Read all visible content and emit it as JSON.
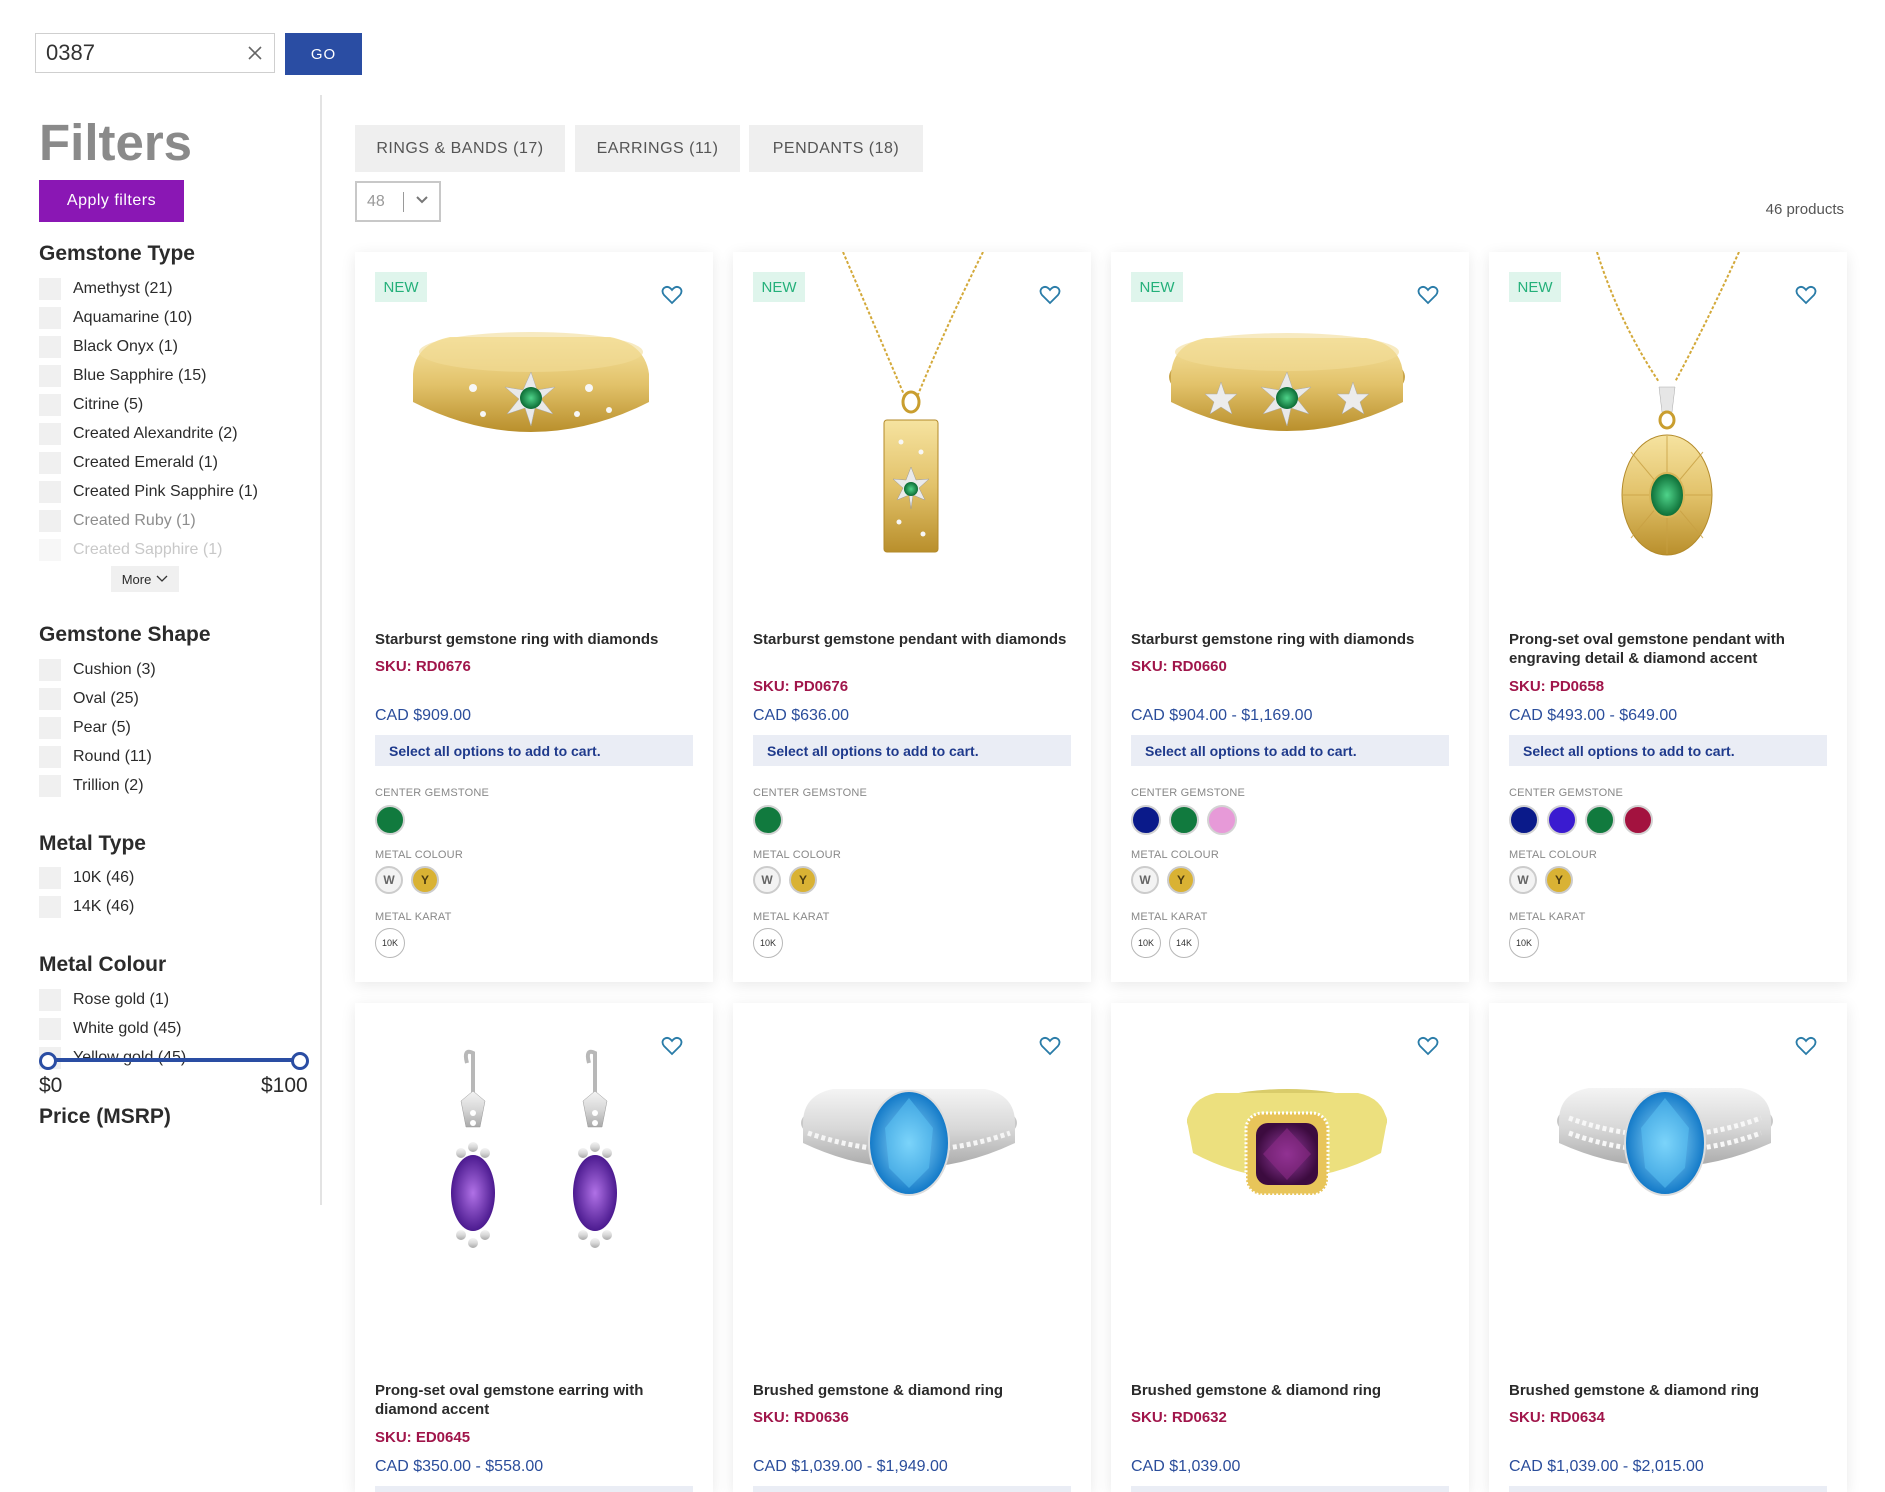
{
  "search": {
    "value": "0387",
    "go_label": "GO"
  },
  "filters": {
    "title": "Filters",
    "apply_label": "Apply filters",
    "more_label": "More",
    "groups": {
      "gemstone_type": {
        "title": "Gemstone Type",
        "options": [
          "Amethyst (21)",
          "Aquamarine (10)",
          "Black Onyx (1)",
          "Blue Sapphire (15)",
          "Citrine (5)",
          "Created Alexandrite (2)",
          "Created Emerald (1)",
          "Created Pink Sapphire (1)",
          "Created Ruby (1)",
          "Created Sapphire (1)"
        ]
      },
      "gemstone_shape": {
        "title": "Gemstone Shape",
        "options": [
          "Cushion (3)",
          "Oval (25)",
          "Pear (5)",
          "Round (11)",
          "Trillion (2)"
        ]
      },
      "metal_type": {
        "title": "Metal Type",
        "options": [
          "10K (46)",
          "14K (46)"
        ]
      },
      "metal_colour": {
        "title": "Metal Colour",
        "options": [
          "Rose gold (1)",
          "White gold (45)",
          "Yellow gold (45)"
        ]
      }
    },
    "price": {
      "title": "Price (MSRP)",
      "min": "$0",
      "max": "$100"
    }
  },
  "categories": [
    "RINGS & BANDS (17)",
    "EARRINGS (11)",
    "PENDANTS (18)"
  ],
  "page_size": "48",
  "product_count": "46 products",
  "option_labels": {
    "gem": "CENTER GEMSTONE",
    "metal": "METAL COLOUR",
    "karat": "METAL KARAT"
  },
  "cart_note": "Select all options to add to cart.",
  "new_label": "NEW",
  "colors": {
    "accent": "#2a4da3",
    "apply": "#8a17b4",
    "sku": "#a0154a",
    "price": "#2a4d9b",
    "new": "#24b07a"
  },
  "products": [
    {
      "name": "Starburst gemstone ring with diamonds",
      "sku": "SKU: RD0676",
      "price": "CAD  $909.00",
      "new": true,
      "gems": [
        "#117a3e"
      ],
      "metals": [
        "W",
        "Y"
      ],
      "karats": [
        "10K"
      ]
    },
    {
      "name": "Starburst gemstone pendant with diamonds",
      "sku": "SKU: PD0676",
      "price": "CAD  $636.00",
      "new": true,
      "gems": [
        "#117a3e"
      ],
      "metals": [
        "W",
        "Y"
      ],
      "karats": [
        "10K"
      ]
    },
    {
      "name": "Starburst gemstone ring with diamonds",
      "sku": "SKU: RD0660",
      "price": "CAD  $904.00 - $1,169.00",
      "new": true,
      "gems": [
        "#0a1a8a",
        "#117a3e",
        "#e79ad8"
      ],
      "metals": [
        "W",
        "Y"
      ],
      "karats": [
        "10K",
        "14K"
      ]
    },
    {
      "name": "Prong-set oval gemstone pendant with engraving detail & diamond accent",
      "sku": "SKU: PD0658",
      "price": "CAD  $493.00 - $649.00",
      "new": true,
      "gems": [
        "#0a1a8a",
        "#3a1bd0",
        "#117a3e",
        "#a3123f"
      ],
      "metals": [
        "W",
        "Y"
      ],
      "karats": [
        "10K"
      ]
    },
    {
      "name": "Prong-set oval gemstone earring with diamond accent",
      "sku": "SKU: ED0645",
      "price": "CAD  $350.00 - $558.00",
      "new": false
    },
    {
      "name": "Brushed gemstone & diamond ring",
      "sku": "SKU: RD0636",
      "price": "CAD  $1,039.00 - $1,949.00",
      "new": false
    },
    {
      "name": "Brushed gemstone & diamond ring",
      "sku": "SKU: RD0632",
      "price": "CAD  $1,039.00",
      "new": false
    },
    {
      "name": "Brushed gemstone & diamond ring",
      "sku": "SKU: RD0634",
      "price": "CAD  $1,039.00 - $2,015.00",
      "new": false
    }
  ]
}
